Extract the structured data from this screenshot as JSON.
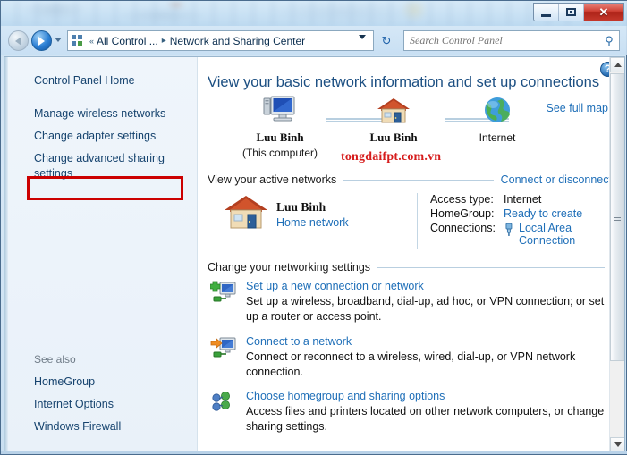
{
  "window": {
    "minimize_label": "–",
    "maximize_label": "□",
    "close_label": "✕"
  },
  "toolbar": {
    "back_title": "Back",
    "forward_title": "Forward",
    "recent_pages_title": "Recent pages",
    "breadcrumb": {
      "chevron": "«",
      "first": "All Control ...",
      "separator": "▸",
      "current": "Network and Sharing Center"
    },
    "refresh_label": "↻",
    "search": {
      "placeholder": "Search Control Panel",
      "value": "",
      "icon": "🔍"
    }
  },
  "sidebar": {
    "items": [
      {
        "label": "Control Panel Home"
      },
      {
        "label": "Manage wireless networks"
      },
      {
        "label": "Change adapter settings"
      },
      {
        "label": "Change advanced sharing settings"
      }
    ],
    "see_also_title": "See also",
    "see_also": [
      {
        "label": "HomeGroup"
      },
      {
        "label": "Internet Options"
      },
      {
        "label": "Windows Firewall"
      }
    ],
    "highlight_color": "#cc0000",
    "highlight_target": "Change adapter settings"
  },
  "main": {
    "help_label": "?",
    "page_title": "View your basic network information and set up connections",
    "see_full_map": "See full map",
    "watermark": "tongdaifpt.com.vn",
    "network_map": {
      "nodes": [
        {
          "icon": "computer-icon",
          "label": "Luu Binh",
          "sub": "(This computer)"
        },
        {
          "icon": "house-icon",
          "label": "Luu Binh",
          "sub": ""
        },
        {
          "icon": "globe-icon",
          "label": "Internet",
          "sub": ""
        }
      ]
    },
    "active_networks": {
      "title": "View your active networks",
      "action_link": "Connect or disconnect",
      "network": {
        "name": "Luu Binh",
        "type": "Home network",
        "icon": "house-icon"
      },
      "details": [
        {
          "key": "Access type:",
          "value": "Internet",
          "is_link": false,
          "icon": ""
        },
        {
          "key": "HomeGroup:",
          "value": "Ready to create",
          "is_link": true,
          "icon": ""
        },
        {
          "key": "Connections:",
          "value": "Local Area Connection",
          "is_link": true,
          "icon": "ethernet-icon"
        }
      ]
    },
    "networking_settings": {
      "title": "Change your networking settings",
      "items": [
        {
          "icon": "new-connection-icon",
          "link": "Set up a new connection or network",
          "description": "Set up a wireless, broadband, dial-up, ad hoc, or VPN connection; or set up a router or access point."
        },
        {
          "icon": "connect-network-icon",
          "link": "Connect to a network",
          "description": "Connect or reconnect to a wireless, wired, dial-up, or VPN network connection."
        },
        {
          "icon": "homegroup-icon",
          "link": "Choose homegroup and sharing options",
          "description": "Access files and printers located on other network computers, or change sharing settings."
        }
      ]
    },
    "scrollbar": {
      "up_label": "▲",
      "down_label": "▼"
    }
  },
  "colors": {
    "link": "#1f6fb8",
    "title": "#1c4f82",
    "highlight": "#cc0000",
    "watermark": "#d61c1c"
  }
}
